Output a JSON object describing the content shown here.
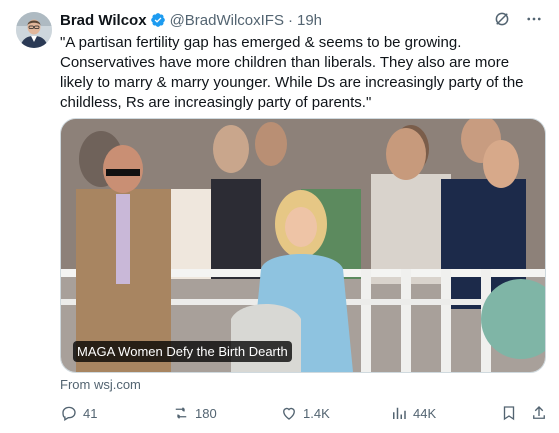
{
  "author": {
    "name": "Brad Wilcox",
    "handle": "@BradWilcoxIFS",
    "separator": "·",
    "time": "19h"
  },
  "tweet_text": "\"A partisan fertility gap has emerged & seems to be growing. Conservatives have more children than liberals. They also are more likely to marry & marry younger. While Ds are increasingly party of the childless, Rs are increasingly party of parents.\"",
  "card": {
    "headline": "MAGA Women Defy the Birth Dearth",
    "source": "From wsj.com"
  },
  "stats": {
    "replies": "41",
    "reposts": "180",
    "likes": "1.4K",
    "views": "44K"
  },
  "colors": {
    "text": "#0f1419",
    "muted": "#536471",
    "verified": "#1d9bf0",
    "border": "#cfd9de"
  }
}
